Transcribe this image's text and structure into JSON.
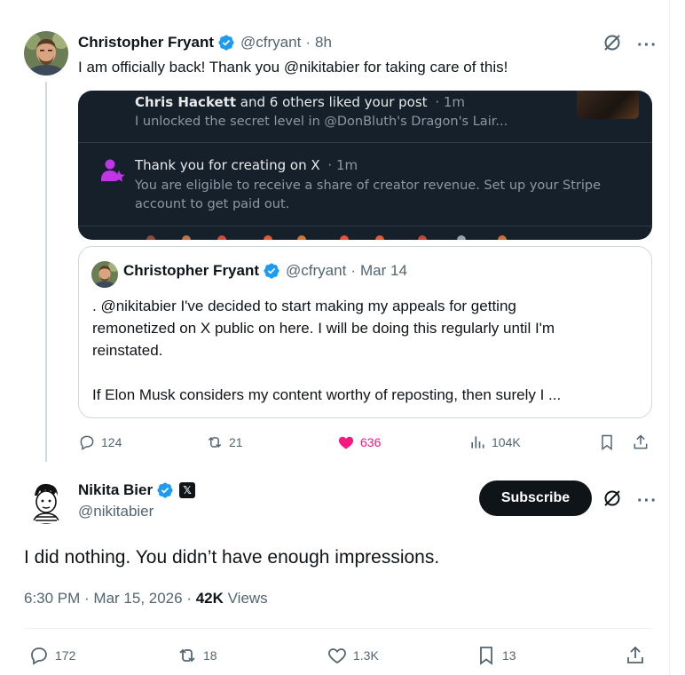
{
  "tweet1": {
    "author_name": "Christopher Fryant",
    "handle": "@cfryant",
    "separator": "·",
    "time": "8h",
    "text": "I am officially back!  Thank you @nikitabier for taking care of this!",
    "media": {
      "notif1_bold": "Chris Hackett",
      "notif1_rest": " and 6 others liked your post",
      "notif1_time": "· 1m",
      "notif1_preview": "I unlocked the secret level in @DonBluth's Dragon's Lair...",
      "notif2_title": "Thank you for creating on X",
      "notif2_time": "· 1m",
      "notif2_line1": "You are eligible to receive a share of creator revenue. Set up your Stripe",
      "notif2_line2": "account to get paid out."
    },
    "quote": {
      "author_name": "Christopher Fryant",
      "handle": "@cfryant",
      "separator": "·",
      "date": "Mar 14",
      "lines": [
        ". @nikitabier  I've decided to start making my appeals for getting",
        "remonetized on X public on here.  I will be doing this regularly until I'm",
        "reinstated.",
        "",
        "If Elon Musk considers my content worthy of reposting, then surely I ..."
      ]
    },
    "actions": {
      "replies": "124",
      "reposts": "21",
      "likes": "636",
      "views": "104K"
    }
  },
  "tweet2": {
    "author_name": "Nikita Bier",
    "handle": "@nikitabier",
    "x_badge": "𝕏",
    "subscribe_label": "Subscribe",
    "text": "I did nothing. You didn’t have enough impressions.",
    "timestamp": "6:30 PM · Mar 15, 2026 ·",
    "views_count": "42K",
    "views_label": "Views",
    "actions": {
      "replies": "172",
      "reposts": "18",
      "likes": "1.3K",
      "bookmarks": "13"
    }
  },
  "colors": {
    "like_active": "#f91880",
    "verified_blue": "#1d9bf0",
    "muted_text": "#536471",
    "dark_media_bg": "#15202b",
    "notif_purple": "#c036e6"
  }
}
